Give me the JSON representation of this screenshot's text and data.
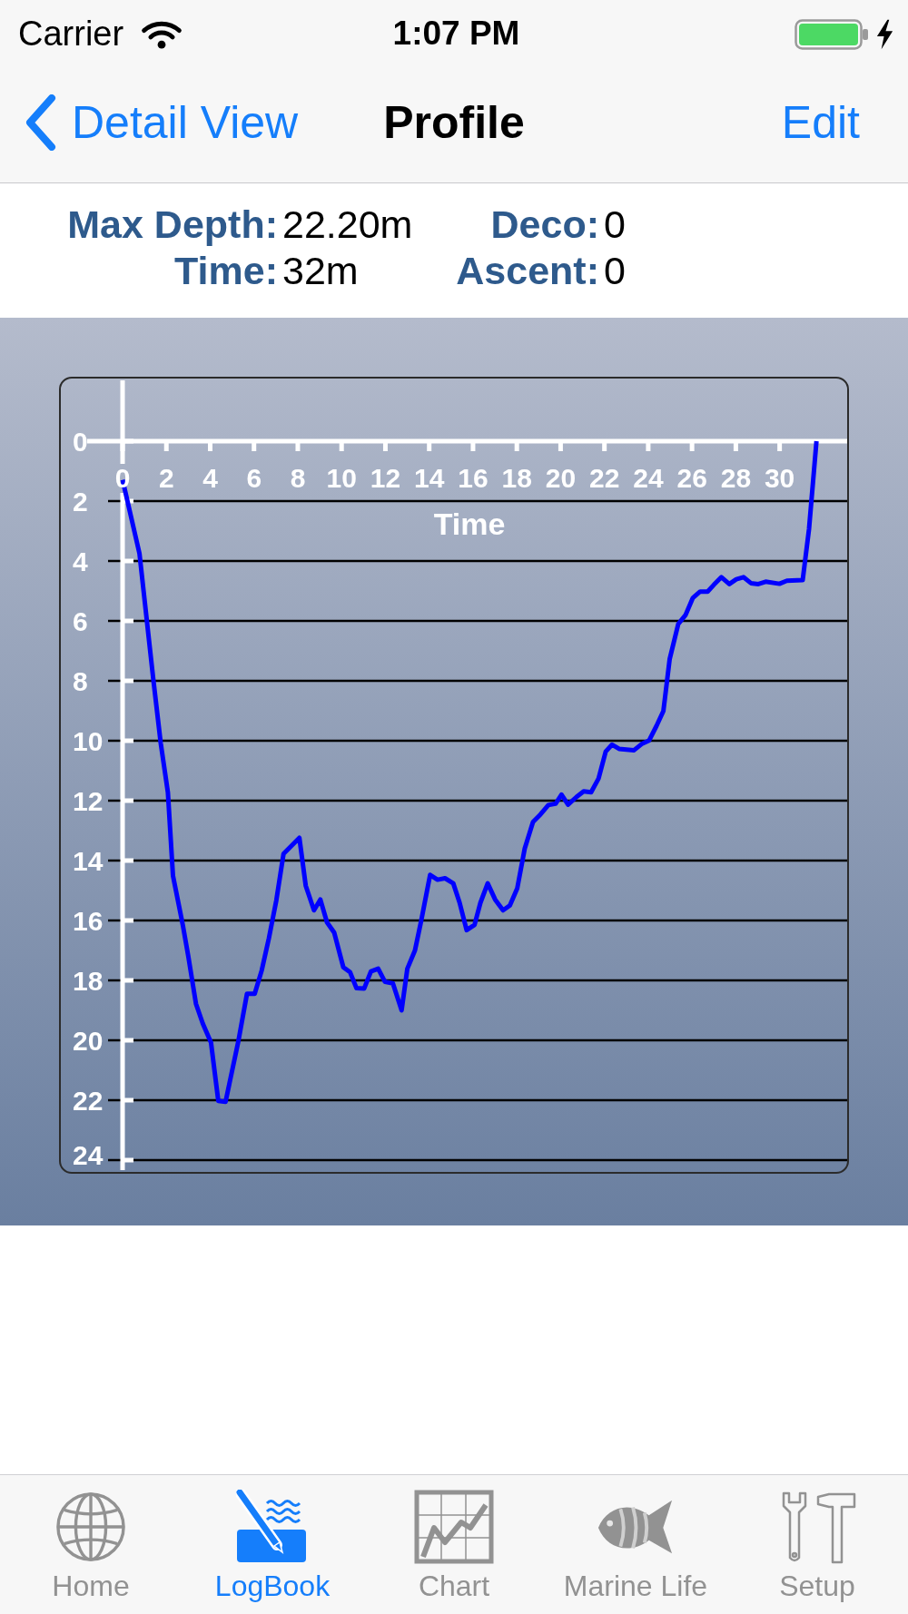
{
  "status_bar": {
    "carrier": "Carrier",
    "time": "1:07 PM"
  },
  "nav_bar": {
    "back": "Detail View",
    "title": "Profile",
    "action": "Edit"
  },
  "stats": [
    {
      "label": "Max Depth:",
      "value": "22.20m"
    },
    {
      "label": "Deco:",
      "value": "0"
    },
    {
      "label": "Time:",
      "value": "32m"
    },
    {
      "label": "Ascent:",
      "value": "0"
    }
  ],
  "profile_chart": {
    "chart_data": {
      "type": "line",
      "xlabel": "Time",
      "grid": true,
      "xlim": [
        0,
        33
      ],
      "ylim": [
        24,
        0
      ],
      "xticks": [
        0,
        2,
        4,
        6,
        8,
        10,
        12,
        14,
        16,
        18,
        20,
        22,
        24,
        26,
        28,
        30
      ],
      "yticks": [
        0,
        2,
        4,
        6,
        8,
        10,
        12,
        14,
        16,
        18,
        20,
        22,
        24
      ],
      "x": [
        0,
        0.77,
        1.4,
        1.74,
        2.07,
        2.3,
        2.75,
        3.0,
        3.35,
        3.66,
        4.04,
        4.37,
        4.7,
        5.28,
        5.68,
        6.03,
        6.35,
        6.68,
        7.02,
        7.35,
        8.07,
        8.36,
        8.74,
        9.03,
        9.33,
        9.66,
        9.91,
        10.08,
        10.39,
        10.68,
        11.03,
        11.34,
        11.67,
        11.98,
        12.34,
        12.74,
        13.0,
        13.35,
        13.64,
        14.04,
        14.38,
        14.72,
        15.1,
        15.39,
        15.71,
        16.07,
        16.34,
        16.67,
        17.01,
        17.37,
        17.68,
        18.02,
        18.36,
        18.74,
        19.08,
        19.44,
        19.77,
        20.04,
        20.34,
        20.72,
        21.05,
        21.39,
        21.73,
        22.06,
        22.35,
        22.67,
        23.34,
        23.7,
        24.04,
        24.38,
        24.69,
        24.98,
        25.37,
        25.7,
        26.04,
        26.37,
        26.71,
        27.0,
        27.34,
        27.7,
        28.02,
        28.35,
        28.69,
        29.03,
        29.36,
        29.99,
        30.33,
        31.05,
        31.34,
        31.68
      ],
      "values": [
        1.29,
        3.75,
        7.94,
        10.08,
        11.72,
        14.51,
        16.15,
        17.2,
        18.78,
        19.44,
        20.08,
        22.02,
        22.05,
        20.05,
        18.45,
        18.45,
        17.67,
        16.6,
        15.33,
        13.77,
        13.24,
        14.84,
        15.66,
        15.3,
        16.06,
        16.4,
        17.09,
        17.56,
        17.73,
        18.26,
        18.27,
        17.7,
        17.61,
        18.05,
        18.1,
        19.0,
        17.61,
        17.0,
        15.99,
        14.48,
        14.64,
        14.59,
        14.76,
        15.41,
        16.32,
        16.15,
        15.41,
        14.76,
        15.3,
        15.66,
        15.5,
        14.92,
        13.6,
        12.71,
        12.46,
        12.15,
        12.1,
        11.8,
        12.13,
        11.88,
        11.69,
        11.72,
        11.26,
        10.36,
        10.13,
        10.27,
        10.32,
        10.11,
        9.99,
        9.5,
        9.01,
        7.28,
        6.1,
        5.81,
        5.23,
        5.02,
        5.02,
        4.79,
        4.54,
        4.77,
        4.61,
        4.54,
        4.74,
        4.77,
        4.69,
        4.76,
        4.66,
        4.64,
        2.93,
        0
      ]
    }
  },
  "tabs": [
    {
      "label": "Home",
      "selected": false
    },
    {
      "label": "LogBook",
      "selected": true
    },
    {
      "label": "Chart",
      "selected": false
    },
    {
      "label": "Marine Life",
      "selected": false
    },
    {
      "label": "Setup",
      "selected": false
    }
  ]
}
